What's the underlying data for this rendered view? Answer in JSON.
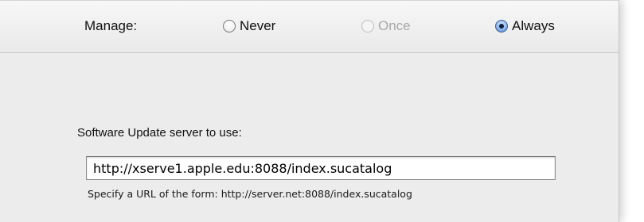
{
  "manage": {
    "label": "Manage:",
    "options": [
      {
        "label": "Never",
        "state": "unselected",
        "enabled": true
      },
      {
        "label": "Once",
        "state": "unselected",
        "enabled": false
      },
      {
        "label": "Always",
        "state": "selected",
        "enabled": true
      }
    ]
  },
  "server": {
    "label": "Software Update server to use:",
    "url_value": "http://xserve1.apple.edu:8088/index.sucatalog",
    "hint": "Specify a URL of the form: http://server.net:8088/index.sucatalog"
  }
}
